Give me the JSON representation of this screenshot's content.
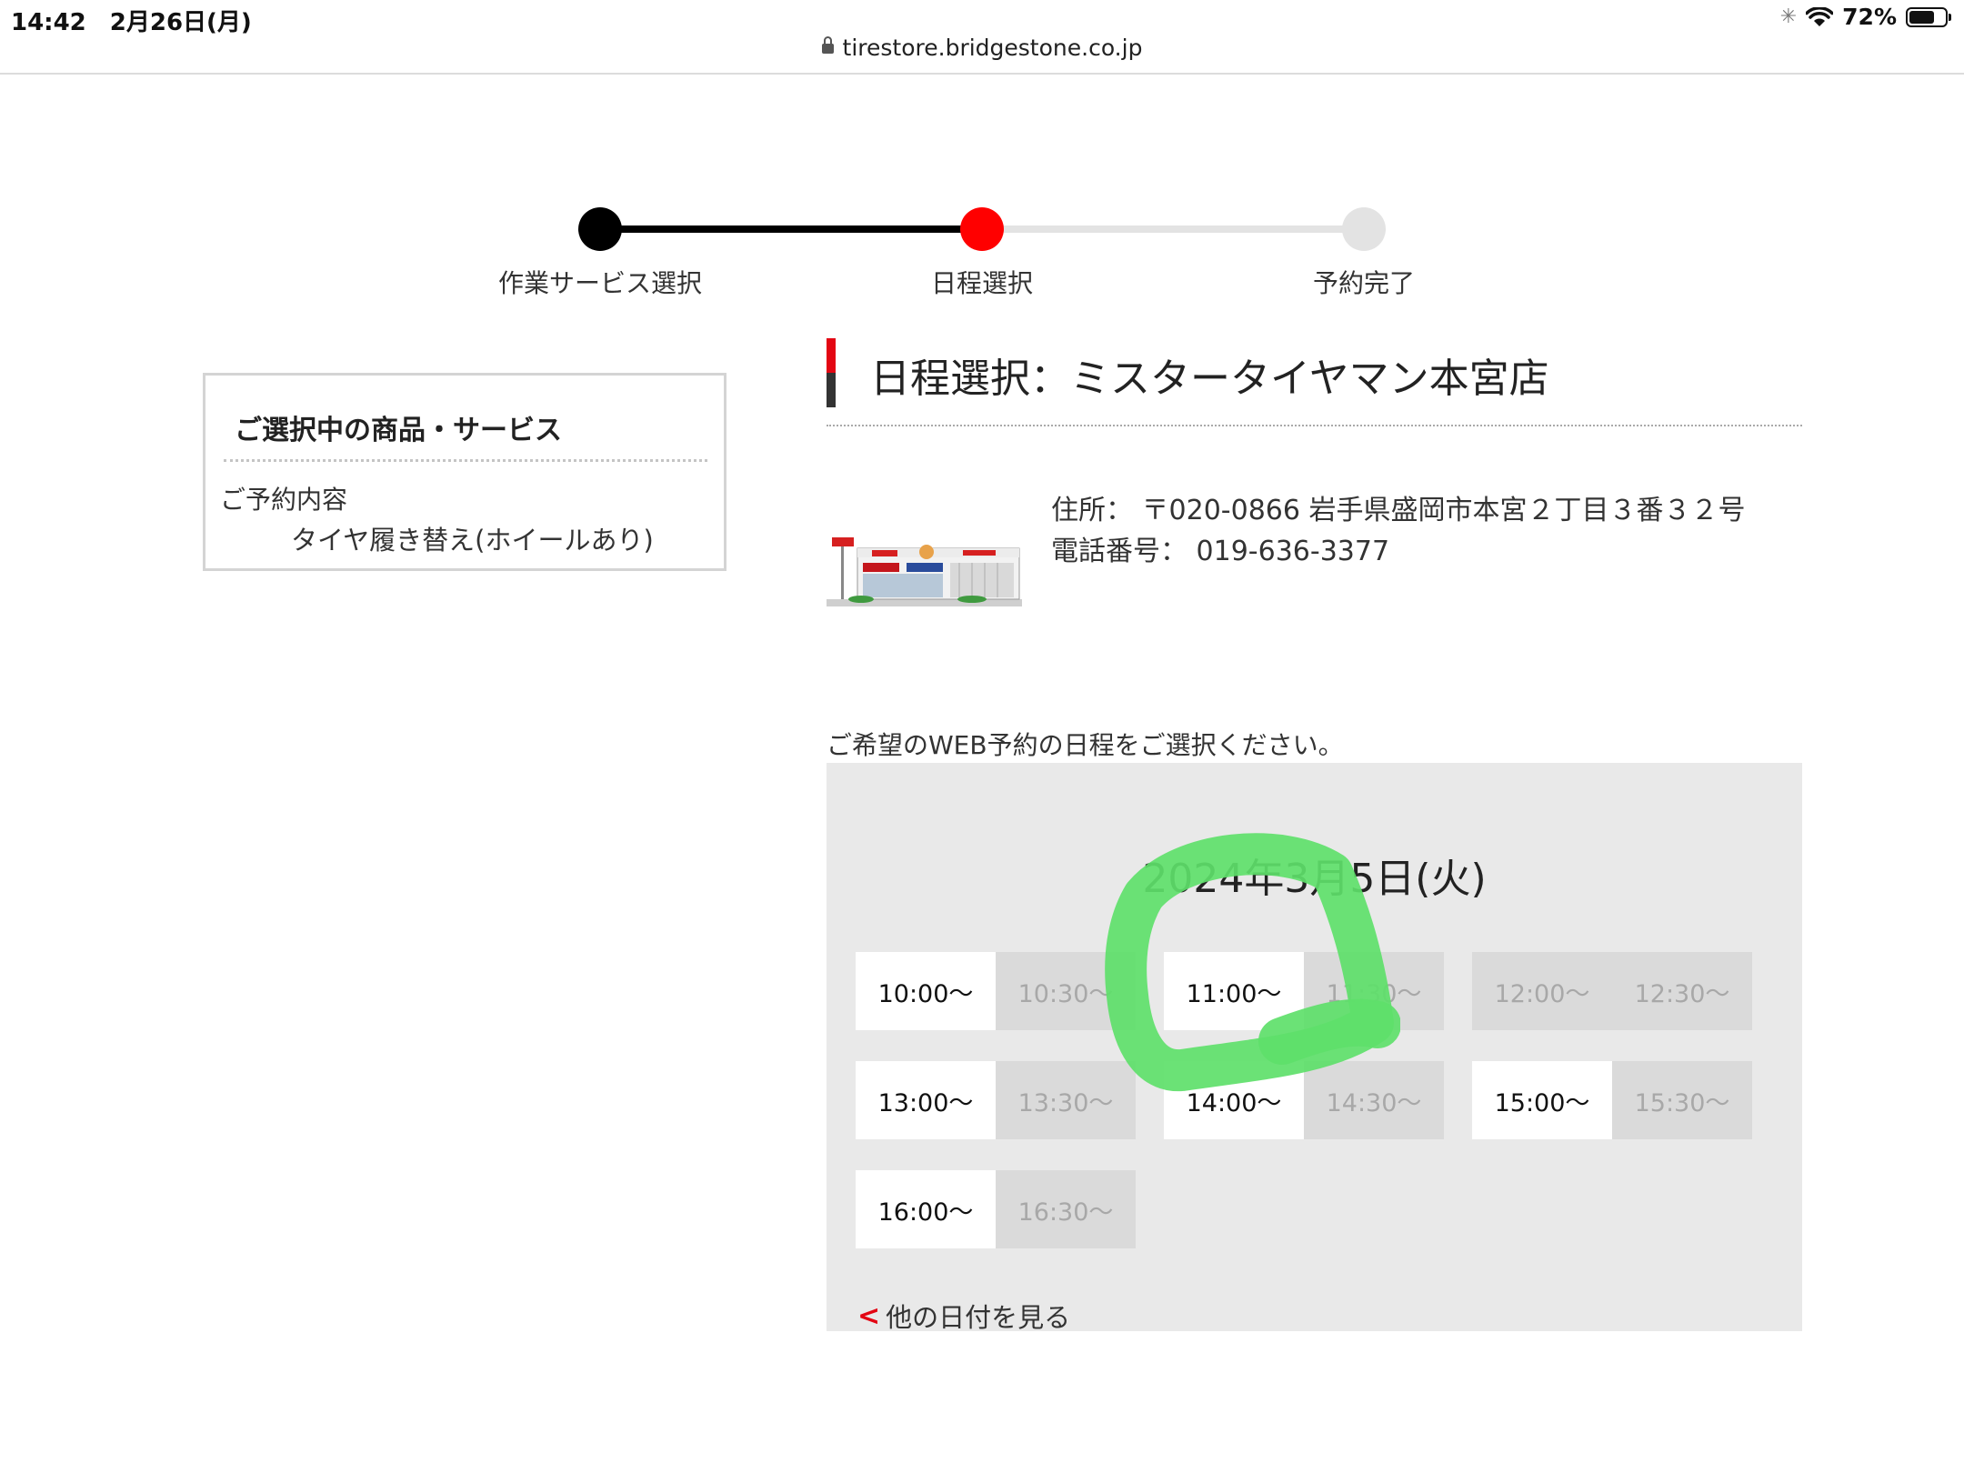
{
  "status_bar": {
    "time_date": "14:42　2月26日(月)",
    "url": "tirestore.bridgestone.co.jp",
    "battery": "72%",
    "battery_level": 0.72,
    "icons": [
      "spinner-icon",
      "wifi-icon",
      "battery-icon",
      "lock-icon"
    ]
  },
  "stepper": {
    "steps": [
      {
        "label": "作業サービス選択",
        "state": "done"
      },
      {
        "label": "日程選択",
        "state": "current"
      },
      {
        "label": "予約完了",
        "state": "pending"
      }
    ],
    "colors": {
      "done": "#000000",
      "current": "#ff0000",
      "pending": "#e3e3e3"
    }
  },
  "selection_panel": {
    "title": "ご選択中の商品・サービス",
    "label": "ご予約内容",
    "value": "タイヤ履き替え(ホイールあり)"
  },
  "store": {
    "heading": "日程選択：ミスタータイヤマン本宮店",
    "address_label": "住所：",
    "address": "〒020-0866 岩手県盛岡市本宮２丁目３番３２号",
    "phone_label": "電話番号：",
    "phone": "019-636-3377"
  },
  "booking": {
    "instruction": "ご希望のWEB予約の日程をご選択ください。",
    "date": "2024年3月5日(火)",
    "slots": [
      {
        "time": "10:00〜",
        "available": true
      },
      {
        "time": "10:30〜",
        "available": false
      },
      {
        "time": "11:00〜",
        "available": true
      },
      {
        "time": "11:30〜",
        "available": false
      },
      {
        "time": "12:00〜",
        "available": false
      },
      {
        "time": "12:30〜",
        "available": false
      },
      {
        "time": "13:00〜",
        "available": true
      },
      {
        "time": "13:30〜",
        "available": false
      },
      {
        "time": "14:00〜",
        "available": true
      },
      {
        "time": "14:30〜",
        "available": false
      },
      {
        "time": "15:00〜",
        "available": true
      },
      {
        "time": "15:30〜",
        "available": false
      },
      {
        "time": "16:00〜",
        "available": true
      },
      {
        "time": "16:30〜",
        "available": false
      }
    ],
    "other_dates": "他の日付を見る"
  },
  "colors": {
    "accent": "#e30613",
    "highlight": "#5ee06a",
    "calendar_bg": "#e9e9e9"
  }
}
